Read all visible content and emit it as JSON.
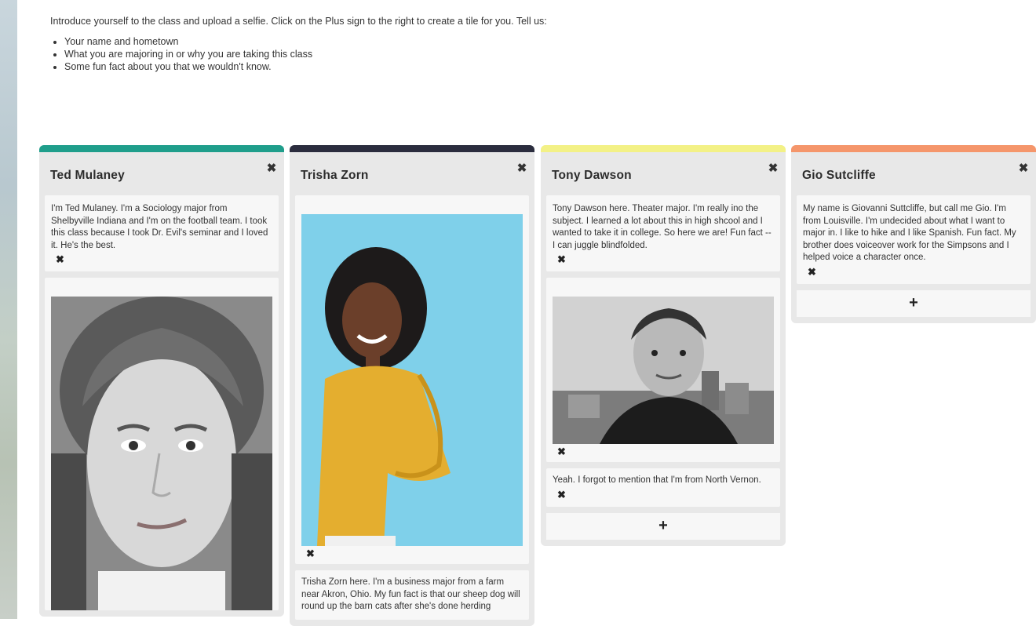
{
  "intro": {
    "text": "Introduce yourself to the class and upload a selfie. Click on the Plus sign to the right to create a tile for you. Tell us:",
    "bullets": [
      "Your name and hometown",
      "What you are majoring in or why you are taking this class",
      "Some fun fact about you that we wouldn't know."
    ]
  },
  "columns": [
    {
      "title": "Ted Mulaney",
      "accent": "#1f9e8b",
      "tiles": [
        "I'm Ted Mulaney. I'm a Sociology major from Shelbyville Indiana and I'm on the football team. I took this class because I took Dr. Evil's seminar and I loved it. He's the best."
      ]
    },
    {
      "title": "Trisha Zorn",
      "accent": "#2b2d3e",
      "tiles": [
        "Trisha Zorn here. I'm a business major from a farm near Akron, Ohio. My fun fact is that our sheep dog will round up the barn cats after she's done herding"
      ]
    },
    {
      "title": "Tony Dawson",
      "accent": "#f3f186",
      "tiles": [
        "Tony Dawson here. Theater major. I'm really ino the subject. I learned a lot about this in high shcool and I wanted to take it in college. So here we are! Fun fact -- I can juggle blindfolded.",
        "Yeah. I forgot to mention that I'm from North Vernon."
      ]
    },
    {
      "title": "Gio Sutcliffe",
      "accent": "#f5966b",
      "tiles": [
        "My name is Giovanni Suttcliffe, but call me Gio. I'm from Louisville. I'm undecided about what I want to major in. I like to hike and I like Spanish. Fun fact. My brother does voiceover work for the Simpsons and I helped voice a character once."
      ]
    }
  ],
  "icons": {
    "close": "✖",
    "add": "+"
  }
}
